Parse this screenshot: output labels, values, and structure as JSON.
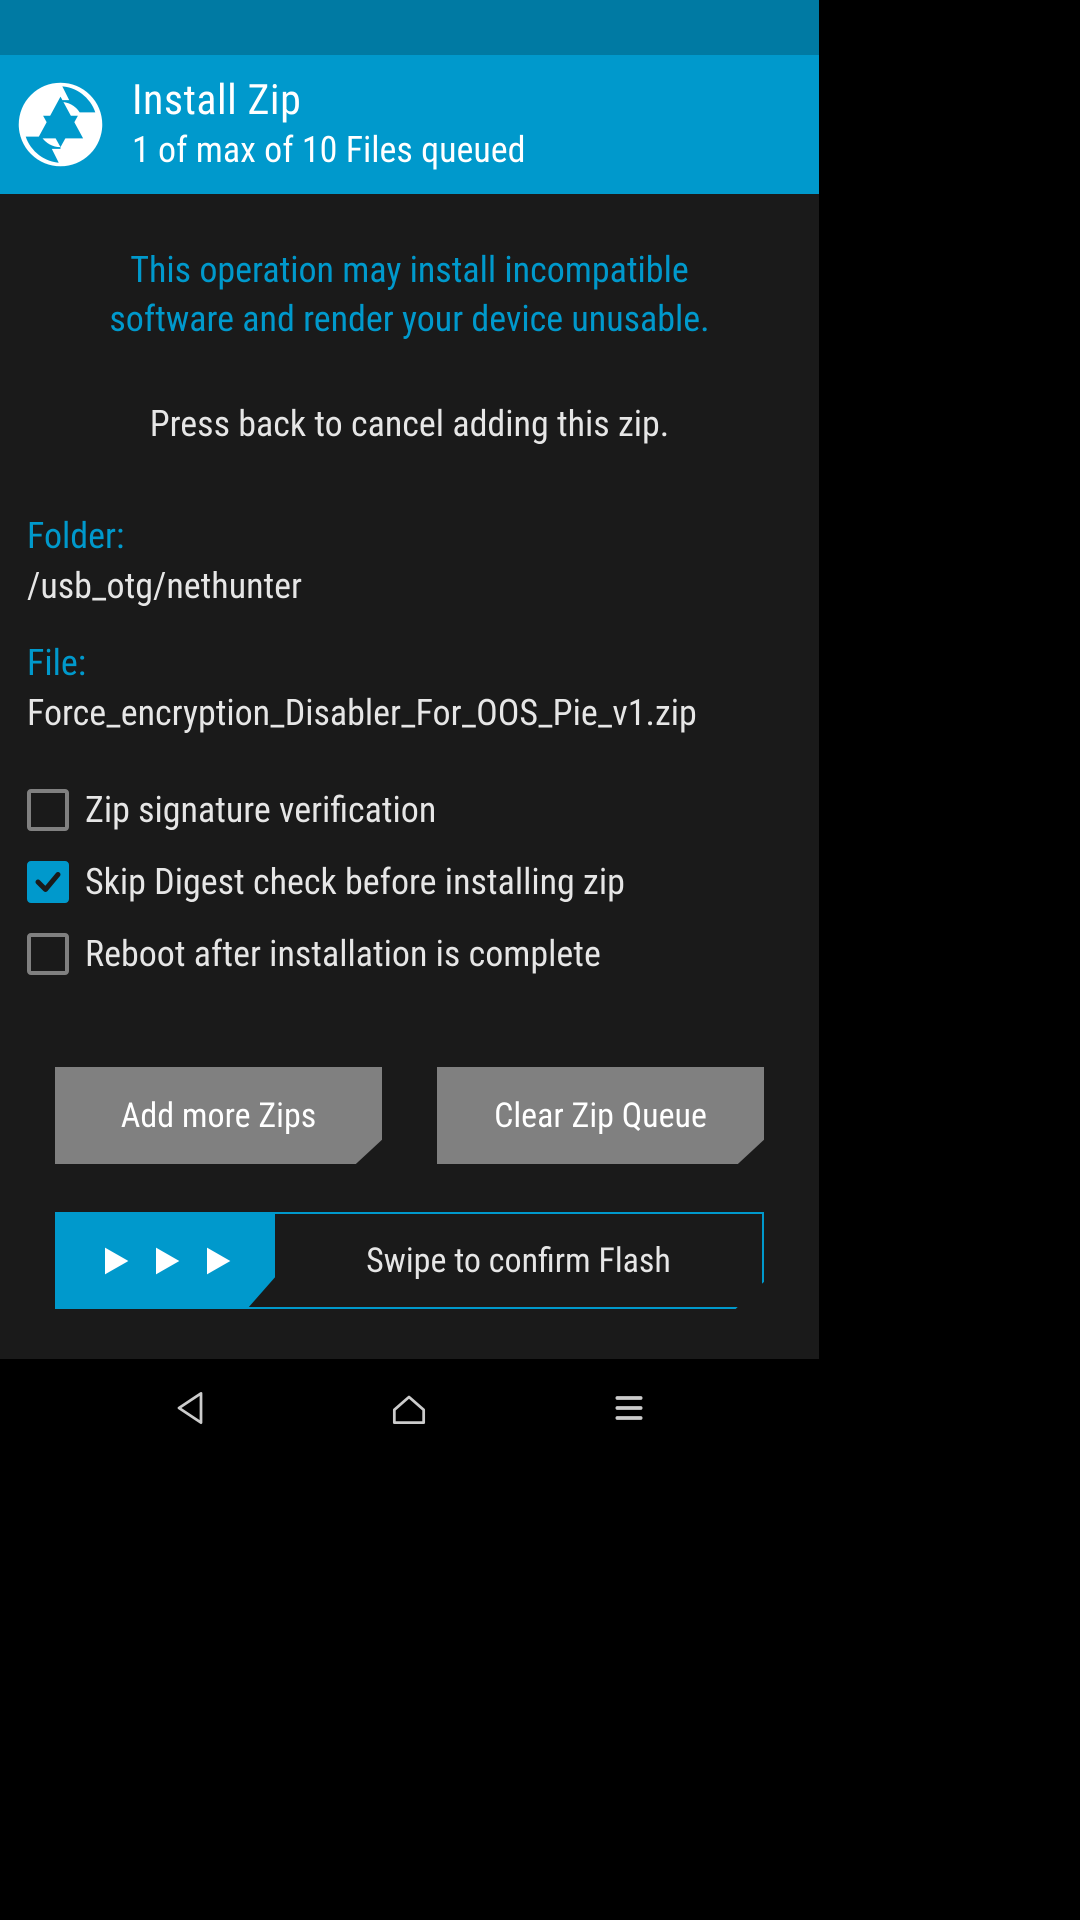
{
  "header": {
    "title": "Install Zip",
    "subtitle": "1 of max of 10 Files queued"
  },
  "warning_line1": "This operation may install incompatible",
  "warning_line2": "software and render your device unusable.",
  "instruction": "Press back to cancel adding this zip.",
  "folder": {
    "label": "Folder:",
    "value": "/usb_otg/nethunter"
  },
  "file": {
    "label": "File:",
    "value": "Force_encryption_Disabler_For_OOS_Pie_v1.zip"
  },
  "options": {
    "zip_sig": {
      "label": "Zip signature verification",
      "checked": false
    },
    "skip_digest": {
      "label": "Skip Digest check before installing zip",
      "checked": true
    },
    "reboot": {
      "label": "Reboot after installation is complete",
      "checked": false
    }
  },
  "buttons": {
    "add_more": "Add more Zips",
    "clear_queue": "Clear Zip Queue"
  },
  "swipe": {
    "label": "Swipe to confirm Flash"
  },
  "colors": {
    "accent": "#0099cc",
    "bg": "#1a1a1a",
    "button": "#808080"
  }
}
